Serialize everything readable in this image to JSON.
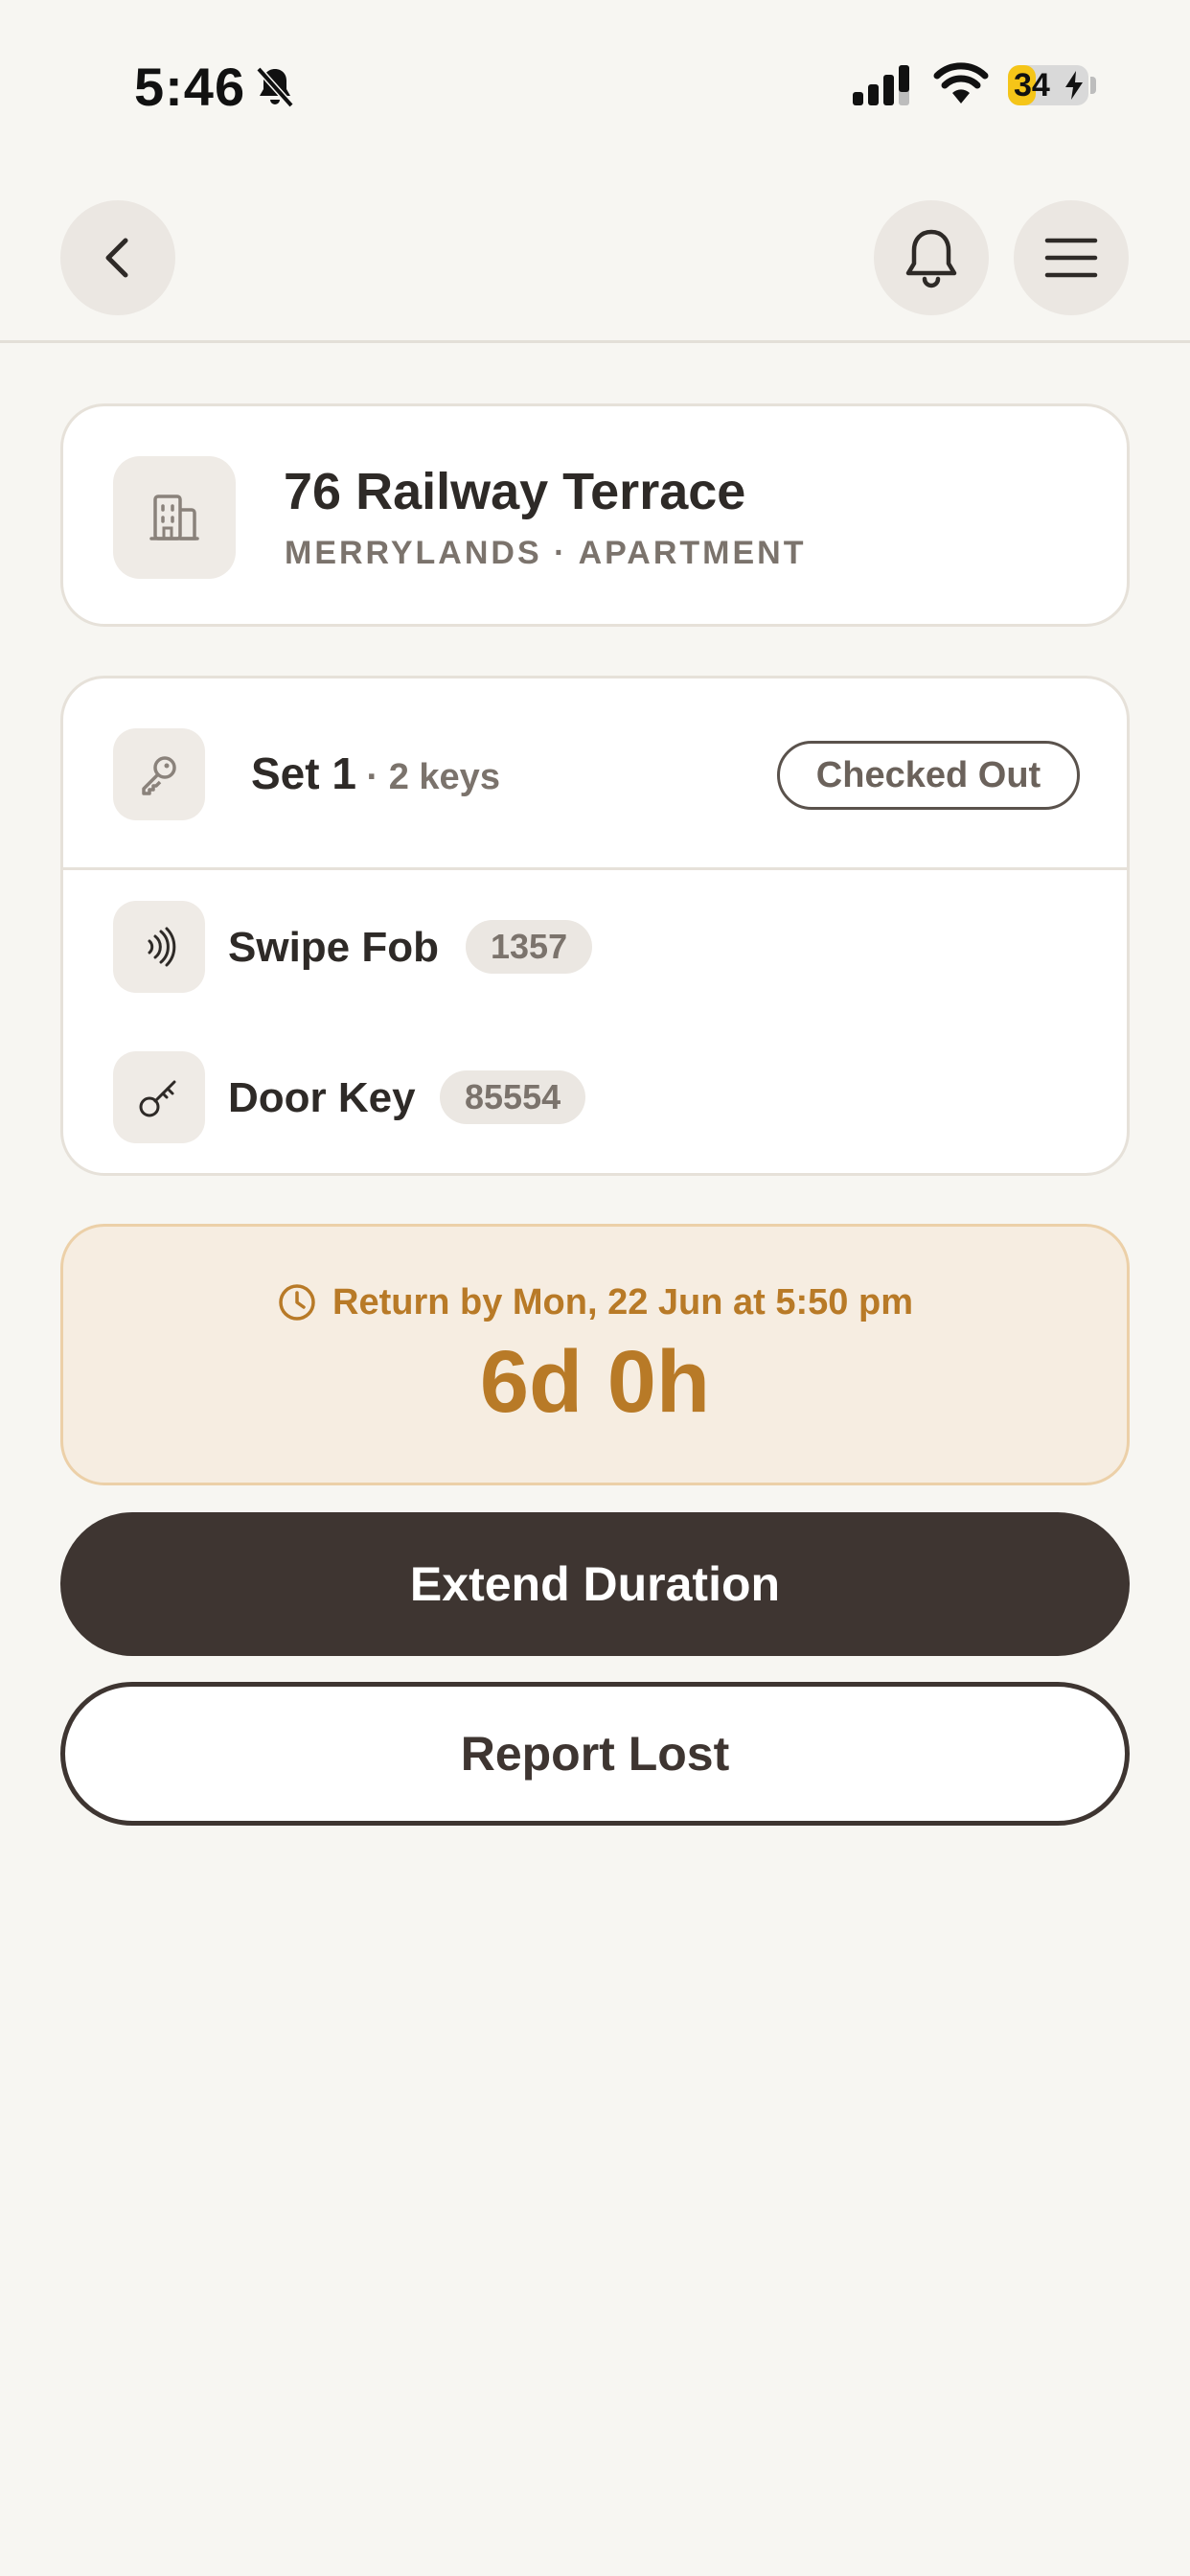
{
  "status_bar": {
    "time": "5:46",
    "battery_level": "34",
    "icons": [
      "bell-slash-icon",
      "signal-icon",
      "wifi-icon",
      "battery-charging-icon"
    ]
  },
  "header": {
    "icons": [
      "chevron-left-icon",
      "bell-icon",
      "hamburger-menu-icon"
    ]
  },
  "property": {
    "name": "76 Railway Terrace",
    "subtitle": "MERRYLANDS · APARTMENT",
    "icon": "building-icon"
  },
  "keyset": {
    "title": "Set 1",
    "count": " · 2 keys",
    "status": "Checked Out",
    "icon": "key-icon",
    "items": [
      {
        "label": "Swipe Fob",
        "code": "1357",
        "icon": "contactless-fob-icon"
      },
      {
        "label": "Door Key",
        "code": "85554",
        "icon": "door-key-icon"
      }
    ]
  },
  "return": {
    "label": "Return by Mon, 22 Jun at 5:50 pm",
    "countdown": "6d 0h",
    "icon": "clock-icon"
  },
  "actions": {
    "extend_label": "Extend Duration",
    "report_label": "Report Lost"
  },
  "colors": {
    "background": "#f7f6f2",
    "accent_amber": "#b87a27",
    "dark_button": "#3e3531",
    "tile": "#efebe6"
  }
}
